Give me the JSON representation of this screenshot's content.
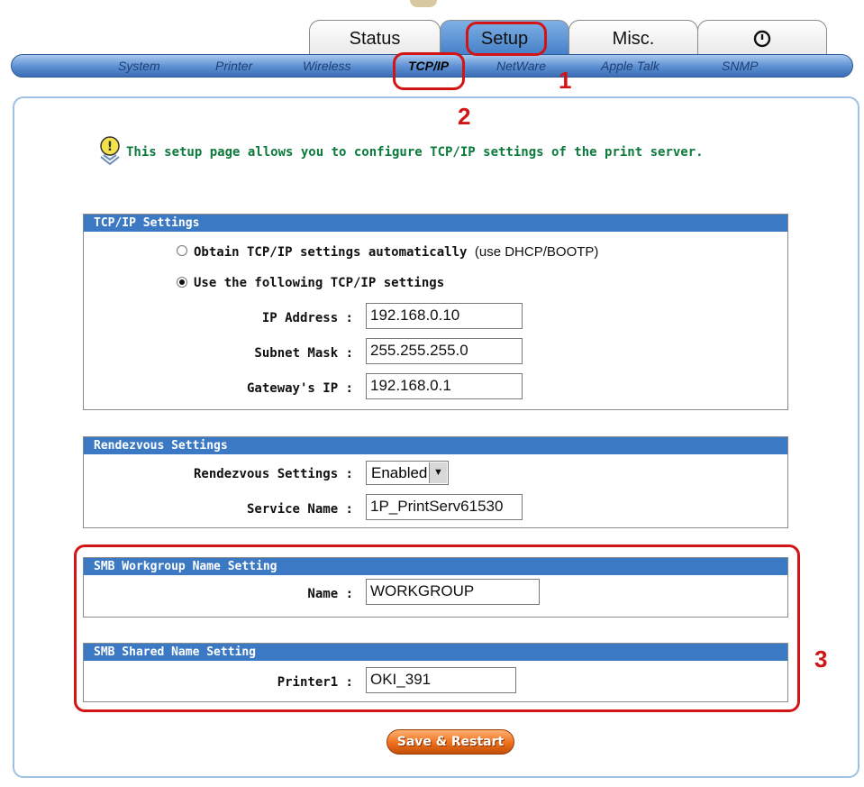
{
  "tabs": [
    {
      "label": "Status"
    },
    {
      "label": "Setup"
    },
    {
      "label": "Misc."
    },
    {
      "label": "power-icon"
    }
  ],
  "subnav": [
    "System",
    "Printer",
    "Wireless",
    "TCP/IP",
    "NetWare",
    "Apple Talk",
    "SNMP"
  ],
  "annotations": {
    "n1": "1",
    "n2": "2",
    "n3": "3"
  },
  "intro": "This setup page allows you to configure TCP/IP settings of the print server.",
  "tcpip": {
    "heading": "TCP/IP Settings",
    "auto_label": "Obtain TCP/IP settings automatically",
    "auto_note": "(use DHCP/BOOTP)",
    "manual_label": "Use the following TCP/IP settings",
    "ip_label": "IP Address :",
    "ip_value": "192.168.0.10",
    "mask_label": "Subnet Mask :",
    "mask_value": "255.255.255.0",
    "gw_label": "Gateway's IP :",
    "gw_value": "192.168.0.1"
  },
  "rendezvous": {
    "heading": "Rendezvous Settings",
    "setting_label": "Rendezvous Settings :",
    "setting_value": "Enabled",
    "service_label": "Service Name :",
    "service_value": "1P_PrintServ61530"
  },
  "smb_workgroup": {
    "heading": "SMB Workgroup Name Setting",
    "name_label": "Name :",
    "name_value": "WORKGROUP"
  },
  "smb_shared": {
    "heading": "SMB Shared Name Setting",
    "printer_label": "Printer1 :",
    "printer_value": "OKI_391"
  },
  "save_label": "Save & Restart",
  "colors": {
    "accent": "#3c79c4",
    "annotation": "#d21414",
    "intro_text": "#0b7a3b",
    "button": "#ee6f1c"
  }
}
